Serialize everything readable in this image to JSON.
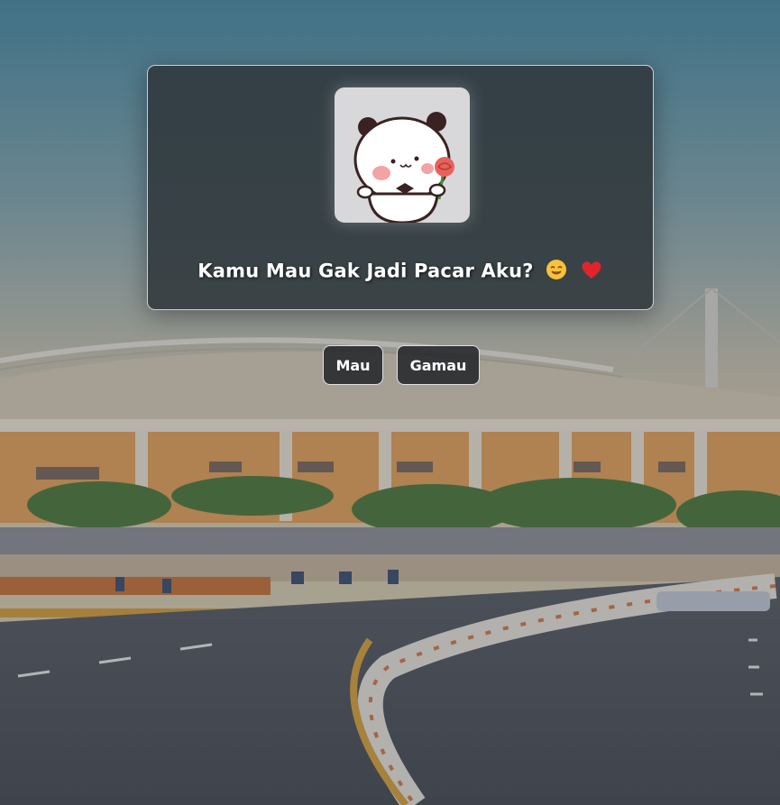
{
  "card": {
    "sticker_icon": "panda-holding-rose-icon",
    "question_text": "Kamu Mau Gak Jadi Pacar Aku?",
    "emojis": [
      "smiling-face-icon",
      "red-heart-icon"
    ]
  },
  "buttons": {
    "yes_label": "Mau",
    "no_label": "Gamau"
  },
  "background": {
    "description_icon": "stadium-street-background"
  },
  "colors": {
    "card_bg": "#30383c",
    "button_bg": "#282a2c",
    "text": "#ffffff"
  }
}
